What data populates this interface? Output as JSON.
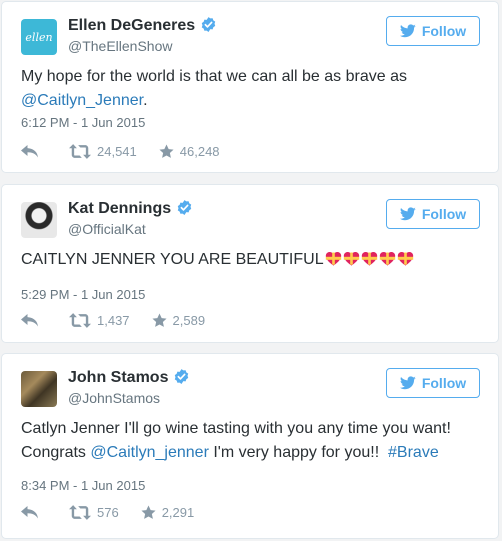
{
  "colors": {
    "accent": "#55acee",
    "link": "#2b7bb9",
    "text": "#292f33",
    "muted": "#66757f",
    "icon": "#8899a6"
  },
  "tweets": [
    {
      "name": "Ellen DeGeneres",
      "handle": "@TheEllenShow",
      "follow_label": "Follow",
      "avatar_text": "ellen",
      "text_before": "My hope for the world is that we can all be as brave as ",
      "mention": "@Caitlyn_Jenner",
      "text_after": ".",
      "timestamp": "6:12 PM - 1 Jun 2015",
      "retweets": "24,541",
      "likes": "46,248"
    },
    {
      "name": "Kat Dennings",
      "handle": "@OfficialKat",
      "follow_label": "Follow",
      "text": "CAITLYN JENNER YOU ARE BEAUTIFUL",
      "emoji": "heart-gift-icon",
      "timestamp": "5:29 PM - 1 Jun 2015",
      "retweets": "1,437",
      "likes": "2,589"
    },
    {
      "name": "John Stamos",
      "handle": "@JohnStamos",
      "follow_label": "Follow",
      "line1": "Catlyn Jenner I'll go wine tasting with you any time you want!",
      "line2_before": "Congrats ",
      "mention": "@Caitlyn_jenner",
      "line2_middle": " I'm very happy for you!!  ",
      "hashtag": "#Brave",
      "timestamp": "8:34 PM - 1 Jun 2015",
      "retweets": "576",
      "likes": "2,291"
    }
  ]
}
